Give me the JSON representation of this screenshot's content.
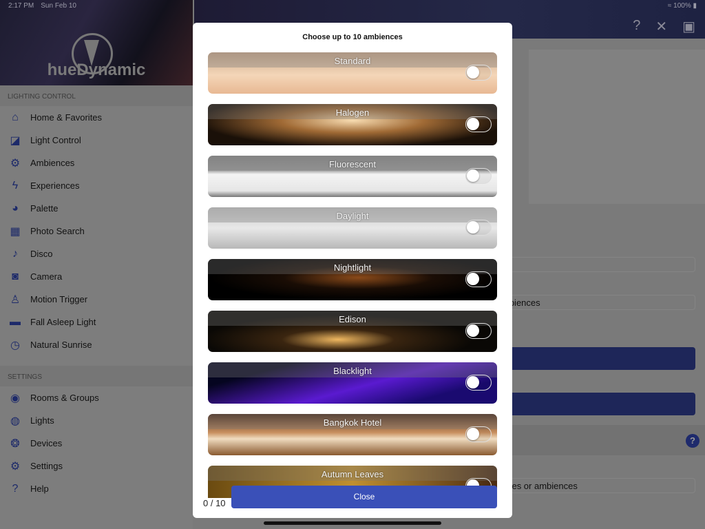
{
  "status": {
    "time": "2:17 PM",
    "date": "Sun Feb 10",
    "battery": "100%"
  },
  "app": {
    "name": "hueDynamic"
  },
  "sidebar": {
    "sections": [
      {
        "title": "LIGHTING CONTROL",
        "items": [
          {
            "label": "Home & Favorites",
            "icon": "home-icon"
          },
          {
            "label": "Light Control",
            "icon": "light-control-icon"
          },
          {
            "label": "Ambiences",
            "icon": "gear-icon"
          },
          {
            "label": "Experiences",
            "icon": "bolt-icon"
          },
          {
            "label": "Palette",
            "icon": "palette-icon"
          },
          {
            "label": "Photo Search",
            "icon": "image-icon"
          },
          {
            "label": "Disco",
            "icon": "music-note-icon"
          },
          {
            "label": "Camera",
            "icon": "camera-icon"
          },
          {
            "label": "Motion Trigger",
            "icon": "walking-icon"
          },
          {
            "label": "Fall Asleep Light",
            "icon": "bed-icon"
          },
          {
            "label": "Natural Sunrise",
            "icon": "alarm-clock-icon"
          }
        ]
      },
      {
        "title": "SETTINGS",
        "items": [
          {
            "label": "Rooms & Groups",
            "icon": "rooms-icon"
          },
          {
            "label": "Lights",
            "icon": "bulb-icon"
          },
          {
            "label": "Devices",
            "icon": "devices-icon"
          },
          {
            "label": "Settings",
            "icon": "gear-icon"
          },
          {
            "label": "Help",
            "icon": "help-icon"
          }
        ]
      }
    ]
  },
  "background": {
    "field1": "",
    "field2": "mbiences",
    "field3": "enes or ambiences"
  },
  "modal": {
    "title": "Choose up to 10 ambiences",
    "ambiences": [
      {
        "label": "Standard",
        "on": false
      },
      {
        "label": "Halogen",
        "on": false
      },
      {
        "label": "Fluorescent",
        "on": false
      },
      {
        "label": "Daylight",
        "on": false
      },
      {
        "label": "Nightlight",
        "on": false
      },
      {
        "label": "Edison",
        "on": false
      },
      {
        "label": "Blacklight",
        "on": false
      },
      {
        "label": "Bangkok Hotel",
        "on": false
      },
      {
        "label": "Autumn Leaves",
        "on": false
      }
    ],
    "count": "0 / 10",
    "close_label": "Close"
  },
  "colors": {
    "accent": "#3a50b8",
    "nav_icon": "#1d2a6a"
  }
}
